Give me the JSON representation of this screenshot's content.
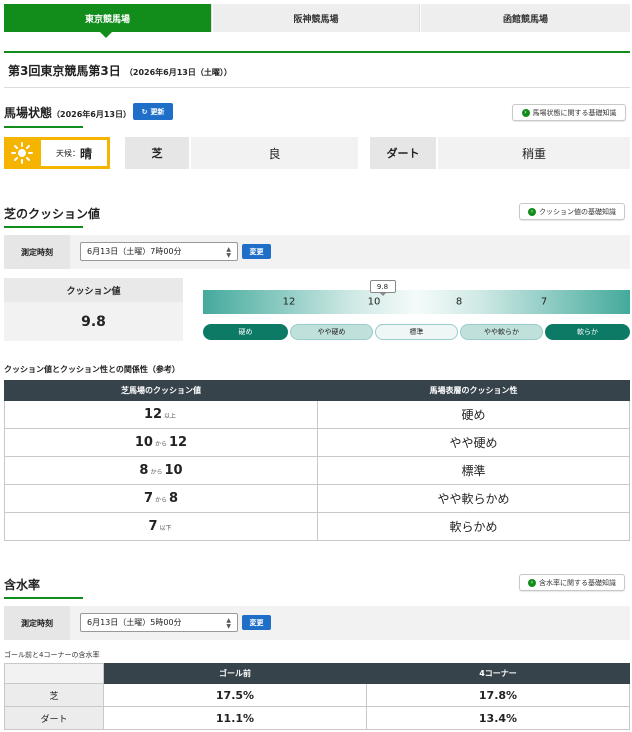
{
  "tabs": [
    {
      "label": "東京競馬場",
      "active": true
    },
    {
      "label": "阪神競馬場",
      "active": false
    },
    {
      "label": "函館競馬場",
      "active": false
    }
  ],
  "meeting_title": "第3回東京競馬第3日",
  "meeting_date": "（2026年6月13日（土曜））",
  "track": {
    "title": "馬場状態",
    "date": "（2026年6月13日）",
    "update_label": "更新",
    "info_label": "馬場状態に関する基礎知識",
    "weather_label": "天候：",
    "weather_value": "晴",
    "turf_label": "芝",
    "turf_value": "良",
    "dirt_label": "ダート",
    "dirt_value": "稍重"
  },
  "cushion": {
    "title": "芝のクッション値",
    "info_label": "クッション値の基礎知識",
    "time_label": "測定時刻",
    "time_value": "6月13日（土曜）7時00分",
    "change_label": "変更",
    "value_label": "クッション値",
    "value": "9.8",
    "marker_value": 9.8,
    "scale_ticks": [
      "12",
      "10",
      "8",
      "7"
    ],
    "segments": [
      "硬め",
      "やや硬め",
      "標準",
      "やや軟らか",
      "軟らか"
    ],
    "table_caption": "クッション値とクッション性との関係性（参考）",
    "table_headers": [
      "芝馬場のクッション値",
      "馬場表層のクッション性"
    ],
    "rows": [
      {
        "a": "12",
        "conn": "以上",
        "b": "",
        "desc": "硬め"
      },
      {
        "a": "10",
        "conn": "から",
        "b": "12",
        "desc": "やや硬め"
      },
      {
        "a": "8",
        "conn": "から",
        "b": "10",
        "desc": "標準"
      },
      {
        "a": "7",
        "conn": "から",
        "b": "8",
        "desc": "やや軟らかめ"
      },
      {
        "a": "7",
        "conn": "以下",
        "b": "",
        "desc": "軟らかめ"
      }
    ]
  },
  "moisture": {
    "title": "含水率",
    "info_label": "含水率に関する基礎知識",
    "time_label": "測定時刻",
    "time_value": "6月13日（土曜）5時00分",
    "change_label": "変更",
    "caption": "ゴール前と4コーナーの含水率",
    "headers": [
      "",
      "ゴール前",
      "4コーナー"
    ],
    "rows": [
      {
        "track": "芝",
        "goal": "17.5%",
        "corner": "17.8%"
      },
      {
        "track": "ダート",
        "goal": "11.1%",
        "corner": "13.4%"
      }
    ]
  },
  "colors": {
    "accent": "#128d1b",
    "button": "#1f6fc9",
    "weather_border": "#f4b400",
    "table_header": "#37434b",
    "teal_dark": "#0d7a66"
  }
}
